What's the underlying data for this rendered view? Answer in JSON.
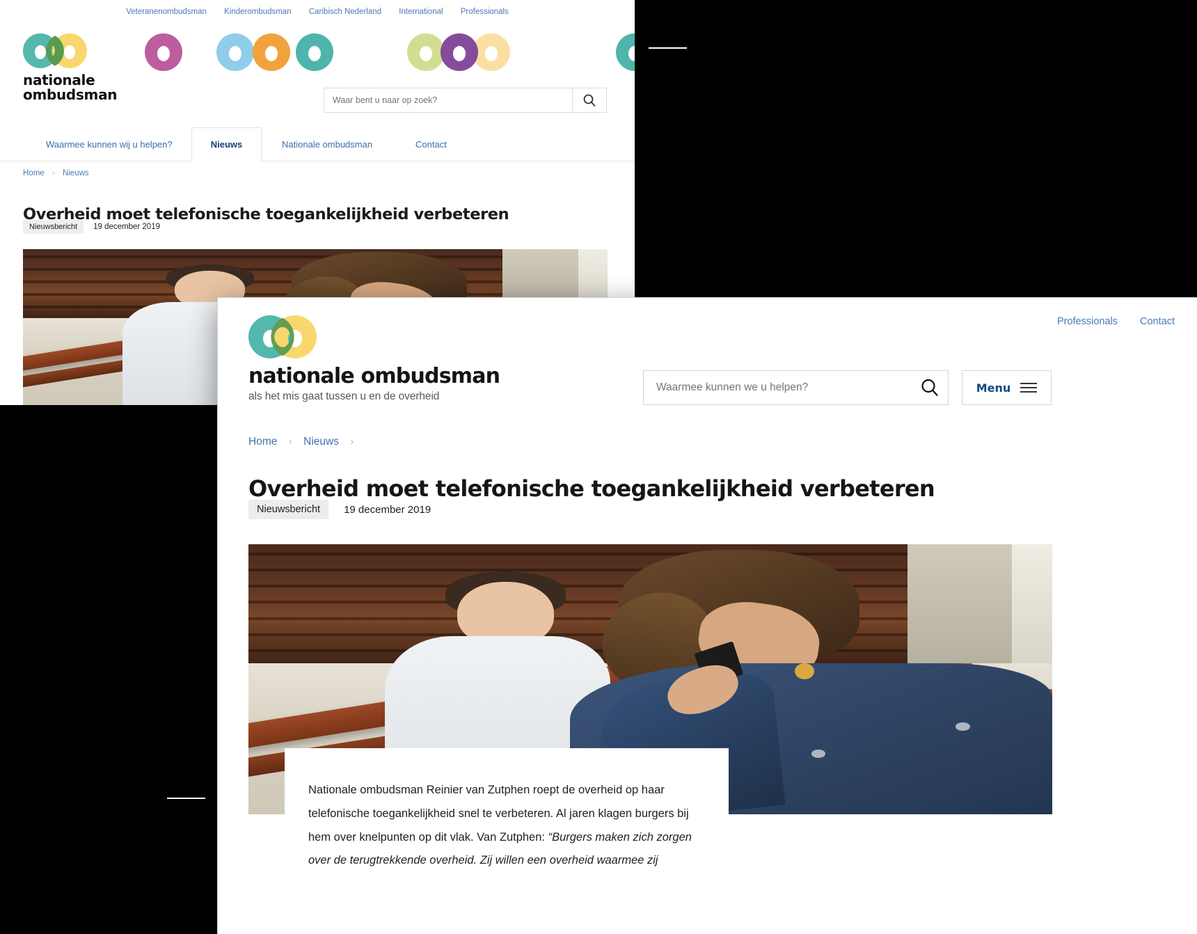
{
  "brand": {
    "name_line1": "nationale",
    "name_line2": "ombudsman",
    "name_inline": "nationale ombudsman",
    "tagline": "als het mis gaat tussen u en de overheid",
    "colors": {
      "teal": "#54b8ad",
      "yellow": "#f8d76e",
      "overlap_green": "#5a9a4f",
      "link_blue": "#4a7ab5",
      "menu_blue": "#11497f"
    }
  },
  "desktop_window": {
    "top_links": [
      {
        "label": "Veteranenombudsman"
      },
      {
        "label": "Kinderombudsman"
      },
      {
        "label": "Caribisch Nederland"
      },
      {
        "label": "International"
      },
      {
        "label": "Professionals"
      }
    ],
    "search": {
      "placeholder": "Waar bent u naar op zoek?",
      "value": "",
      "button_icon": "search-icon"
    },
    "tabs": [
      {
        "label": "Waarmee kunnen wij u helpen?",
        "active": false
      },
      {
        "label": "Nieuws",
        "active": true
      },
      {
        "label": "Nationale ombudsman",
        "active": false
      },
      {
        "label": "Contact",
        "active": false
      }
    ],
    "breadcrumb": [
      {
        "label": "Home"
      },
      {
        "label": "Nieuws"
      }
    ],
    "breadcrumb_separator": "›",
    "article": {
      "title": "Overheid moet telefonische toegankelijkheid verbeteren",
      "badge": "Nieuwsbericht",
      "date": "19 december 2019"
    },
    "decor_rings": [
      {
        "color": "#bd5d9e",
        "overlap": false
      },
      {
        "color": "#8fcdea",
        "overlap": false
      },
      {
        "color": "#f2a23c",
        "overlap": false
      },
      {
        "color": "#4fb4ab",
        "overlap": false
      },
      {
        "color": "#d2dd92",
        "overlap": false
      },
      {
        "color": "#7b3d96",
        "overlap": true
      },
      {
        "color": "#fbdfa2",
        "overlap": true
      },
      {
        "color": "#4fb4ab",
        "overlap": false
      }
    ]
  },
  "mobile_window": {
    "top_links": [
      {
        "label": "Professionals"
      },
      {
        "label": "Contact"
      }
    ],
    "search": {
      "placeholder": "Waarmee kunnen we u helpen?",
      "value": "",
      "icon": "search-icon"
    },
    "menu": {
      "label": "Menu",
      "icon": "hamburger-icon"
    },
    "breadcrumb": [
      {
        "label": "Home"
      },
      {
        "label": "Nieuws"
      }
    ],
    "breadcrumb_separator": "›",
    "article": {
      "title": "Overheid moet telefonische toegankelijkheid verbeteren",
      "badge": "Nieuwsbericht",
      "date": "19 december 2019",
      "intro_plain_1": "Nationale ombudsman Reinier van Zutphen roept de overheid op haar telefonische toegankelijkheid snel te verbeteren. Al jaren klagen burgers bij hem over knelpunten op dit vlak. Van Zutphen: ",
      "intro_quote": "“Burgers maken zich zorgen over de terugtrekkende overheid. Zij willen een overheid waarmee zij"
    },
    "photo_alt": "Vrouw met telefoon aan oor op een bankje, jongen op achtergrond"
  }
}
